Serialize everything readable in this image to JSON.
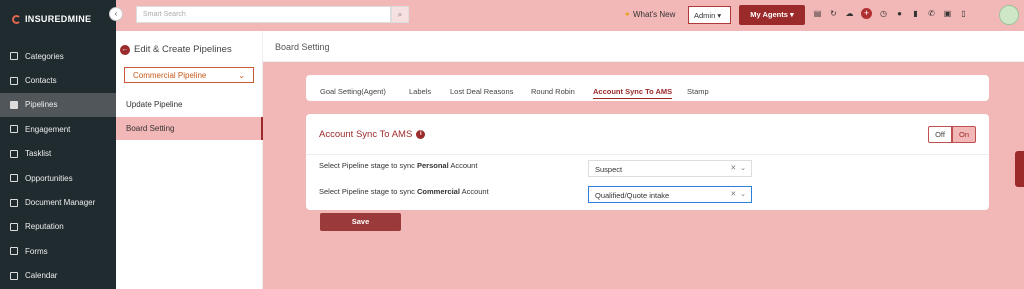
{
  "brand": {
    "name": "INSUREDMINE"
  },
  "sidebar": {
    "collapse_icon": "chevron-left-icon",
    "items": [
      {
        "label": "Categories",
        "icon": "list-icon"
      },
      {
        "label": "Contacts",
        "icon": "contacts-icon"
      },
      {
        "label": "Pipelines",
        "icon": "filter-icon",
        "active": true
      },
      {
        "label": "Engagement",
        "icon": "megaphone-icon"
      },
      {
        "label": "Tasklist",
        "icon": "task-icon"
      },
      {
        "label": "Opportunities",
        "icon": "chart-icon"
      },
      {
        "label": "Document Manager",
        "icon": "folder-icon"
      },
      {
        "label": "Reputation",
        "icon": "star-icon"
      },
      {
        "label": "Forms",
        "icon": "form-icon"
      },
      {
        "label": "Calendar",
        "icon": "calendar-icon"
      }
    ]
  },
  "topbar": {
    "search_placeholder": "Smart Search",
    "whats_new": "What's New",
    "admin": "Admin",
    "my_agents": "My Agents"
  },
  "subpanel": {
    "title": "Edit & Create Pipelines",
    "pipeline": "Commercial Pipeline",
    "links": [
      "Update Pipeline",
      "Board Setting"
    ]
  },
  "main": {
    "header": "Board Setting",
    "tabs": [
      "Goal Setting(Agent)",
      "Labels",
      "Lost Deal Reasons",
      "Round Robin",
      "Account Sync To AMS",
      "Stamp"
    ],
    "active_tab": "Account Sync To AMS"
  },
  "card": {
    "title": "Account Sync To AMS",
    "toggle_off": "Off",
    "toggle_on": "On",
    "row1": {
      "label_pre": "Select Pipeline stage to sync ",
      "label_bold": "Personal",
      "label_post": " Account",
      "value": "Suspect"
    },
    "row2": {
      "label_pre": "Select Pipeline stage to sync ",
      "label_bold": "Commercial",
      "label_post": " Account",
      "value": "Qualified/Quote intake"
    },
    "save": "Save"
  },
  "colors": {
    "accent": "#9b2a2a",
    "background": "#f2b7b7",
    "sidebar": "#1f2b2f"
  }
}
